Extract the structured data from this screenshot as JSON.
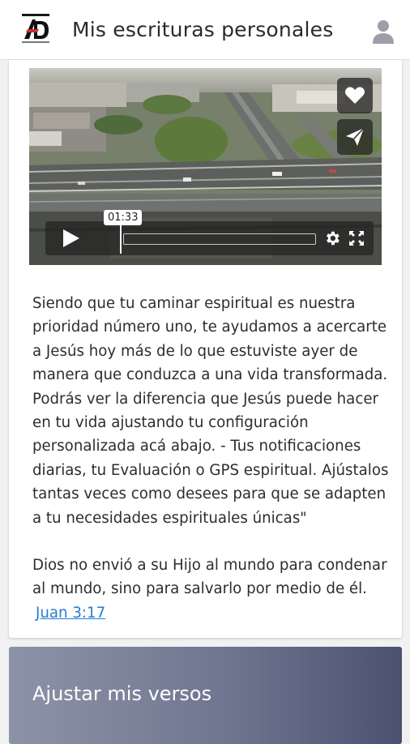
{
  "header": {
    "title": "Mis escrituras personales",
    "logo_icon": "logo-icon",
    "profile_icon": "user-icon"
  },
  "video": {
    "time_badge": "01:33",
    "progress": 0,
    "actions": [
      "heart-icon",
      "send-icon"
    ],
    "controls": [
      "play-icon",
      "gear-icon",
      "fullscreen-icon"
    ]
  },
  "content": {
    "paragraph": "Siendo que tu caminar espiritual es nuestra prioridad número uno, te ayudamos a acercarte a Jesús hoy más de lo que estuviste ayer de manera que conduzca a una vida transformada. Podrás ver la diferencia que Jesús puede hacer en tu vida ajustando tu configuración personalizada acá abajo. - Tus notificaciones diarias, tu Evaluación o GPS espiritual. Ajústalos tantas veces como desees para que se adapten a tu necesidades espirituales únicas\"",
    "verse": "Dios no envió a su Hijo al mundo para condenar al mundo, sino para salvarlo por medio de él.",
    "verse_reference": "Juan 3:17"
  },
  "adjust_section": {
    "title": "Ajustar mis versos"
  },
  "colors": {
    "link": "#2a7bd4",
    "header_bg": "#ffffff",
    "adjust_card_gradient": [
      "#8d93a7",
      "#4b5270"
    ]
  }
}
